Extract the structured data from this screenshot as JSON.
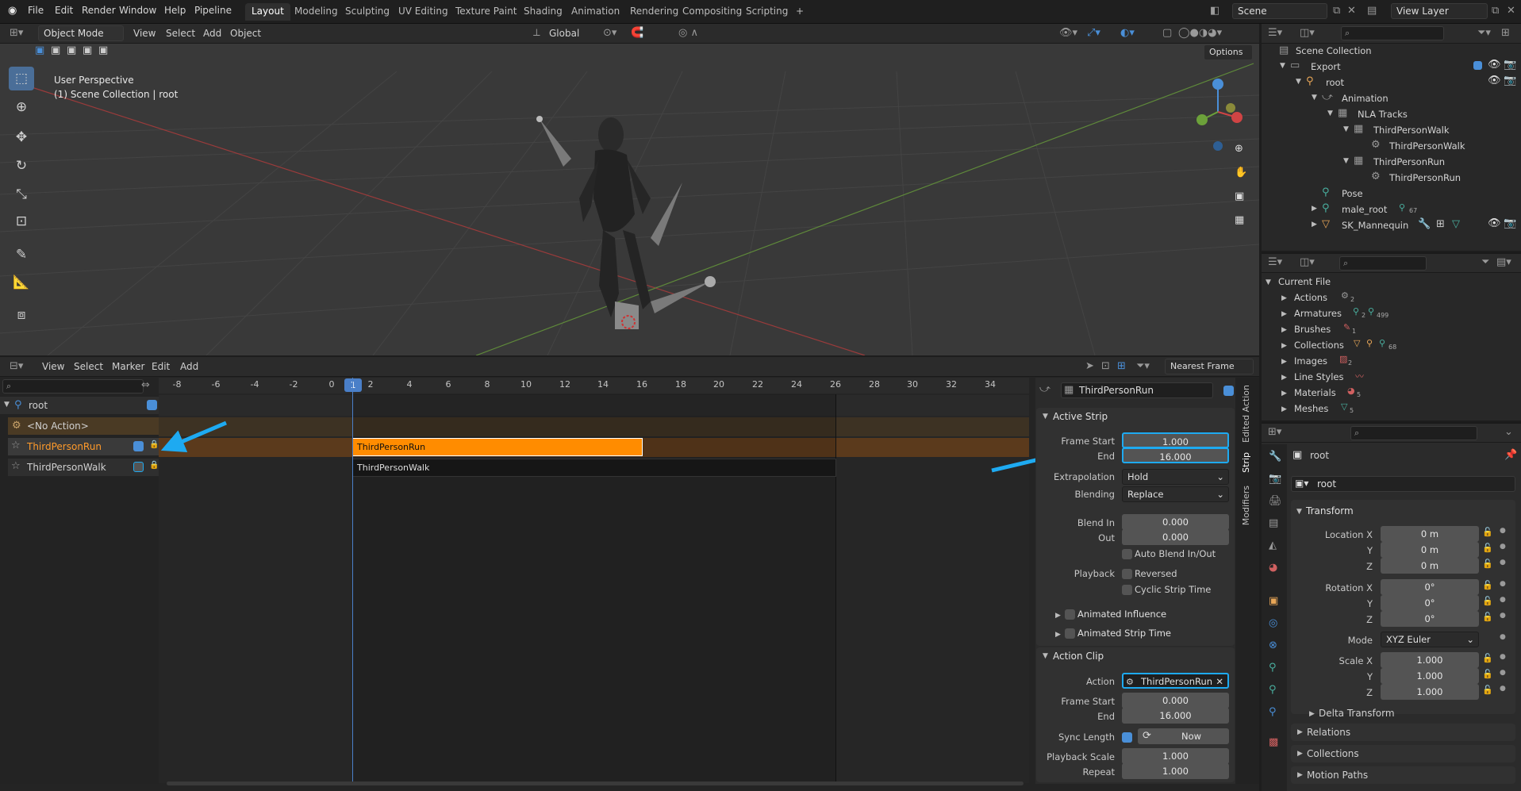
{
  "menubar": {
    "items": [
      "File",
      "Edit",
      "Render",
      "Window",
      "Help",
      "Pipeline"
    ],
    "workspaces": [
      "Layout",
      "Modeling",
      "Sculpting",
      "UV Editing",
      "Texture Paint",
      "Shading",
      "Animation",
      "Rendering",
      "Compositing",
      "Scripting"
    ],
    "add_tab": "+",
    "scene": "Scene",
    "view_layer": "View Layer"
  },
  "viewport": {
    "mode": "Object Mode",
    "menus": [
      "View",
      "Select",
      "Add",
      "Object"
    ],
    "orientation": "Global",
    "options": "Options",
    "title": "User Perspective",
    "subtitle": "(1) Scene Collection | root"
  },
  "outliner": {
    "search_placeholder": "",
    "rows": [
      {
        "label": "Scene Collection"
      },
      {
        "label": "Export"
      },
      {
        "label": "root"
      },
      {
        "label": "Animation"
      },
      {
        "label": "NLA Tracks"
      },
      {
        "label": "ThirdPersonWalk"
      },
      {
        "label": "ThirdPersonWalk"
      },
      {
        "label": "ThirdPersonRun"
      },
      {
        "label": "ThirdPersonRun"
      },
      {
        "label": "Pose"
      },
      {
        "label": "male_root"
      },
      {
        "label": "SK_Mannequin"
      }
    ],
    "male_root_badge": "67"
  },
  "blendfile": {
    "title": "Current File",
    "rows": [
      {
        "label": "Actions",
        "count": "2"
      },
      {
        "label": "Armatures",
        "count": "2",
        "count2": "499"
      },
      {
        "label": "Brushes",
        "count": "1"
      },
      {
        "label": "Collections",
        "count": "68"
      },
      {
        "label": "Images",
        "count": "2"
      },
      {
        "label": "Line Styles",
        "count": ""
      },
      {
        "label": "Materials",
        "count": "5"
      },
      {
        "label": "Meshes",
        "count": "5"
      }
    ]
  },
  "properties": {
    "object_name": "root",
    "data_name": "root",
    "transform_title": "Transform",
    "location_label": "Location X",
    "loc_x": "0 m",
    "loc_y": "0 m",
    "loc_z": "0 m",
    "rotation_label": "Rotation X",
    "rot_x": "0°",
    "rot_y": "0°",
    "rot_z": "0°",
    "mode_label": "Mode",
    "mode_value": "XYZ Euler",
    "scale_label": "Scale X",
    "scale_x": "1.000",
    "scale_y": "1.000",
    "scale_z": "1.000",
    "y": "Y",
    "z": "Z",
    "sections": [
      "Delta Transform",
      "Relations",
      "Collections",
      "Motion Paths"
    ]
  },
  "nla": {
    "menus": [
      "View",
      "Select",
      "Marker",
      "Edit",
      "Add"
    ],
    "snap": "Nearest Frame",
    "ruler": [
      "-8",
      "-6",
      "-4",
      "-2",
      "0",
      "1",
      "2",
      "4",
      "6",
      "8",
      "10",
      "12",
      "14",
      "16",
      "18",
      "20",
      "22",
      "24",
      "26",
      "28",
      "30",
      "32",
      "34"
    ],
    "current_frame": "1",
    "tracks": [
      {
        "label": "root"
      },
      {
        "label": "<No Action>"
      },
      {
        "label": "ThirdPersonRun"
      },
      {
        "label": "ThirdPersonWalk"
      }
    ],
    "strip_run": "ThirdPersonRun",
    "strip_walk": "ThirdPersonWalk"
  },
  "sidebar": {
    "strip_name": "ThirdPersonRun",
    "tabs": [
      "Edited Action",
      "Strip",
      "Modifiers"
    ],
    "active_strip": {
      "title": "Active Strip",
      "frame_start_label": "Frame Start",
      "frame_start": "1.000",
      "end_label": "End",
      "end": "16.000",
      "extrapolation_label": "Extrapolation",
      "extrapolation": "Hold",
      "blending_label": "Blending",
      "blending": "Replace",
      "blend_in_label": "Blend In",
      "blend_in": "0.000",
      "out_label": "Out",
      "out": "0.000",
      "auto_blend": "Auto Blend In/Out",
      "playback_label": "Playback",
      "reversed": "Reversed",
      "cyclic": "Cyclic Strip Time",
      "animated_influence": "Animated Influence",
      "animated_strip_time": "Animated Strip Time"
    },
    "action_clip": {
      "title": "Action Clip",
      "action_label": "Action",
      "action": "ThirdPersonRun",
      "frame_start_label": "Frame Start",
      "frame_start": "0.000",
      "end_label": "End",
      "end": "16.000",
      "sync_label": "Sync Length",
      "now": "Now",
      "playback_scale_label": "Playback Scale",
      "playback_scale": "1.000",
      "repeat_label": "Repeat",
      "repeat": "1.000"
    }
  },
  "colors": {
    "accent": "#4a8fd8",
    "strip_active": "#ff8c00",
    "annotation": "#1eaaf1"
  }
}
